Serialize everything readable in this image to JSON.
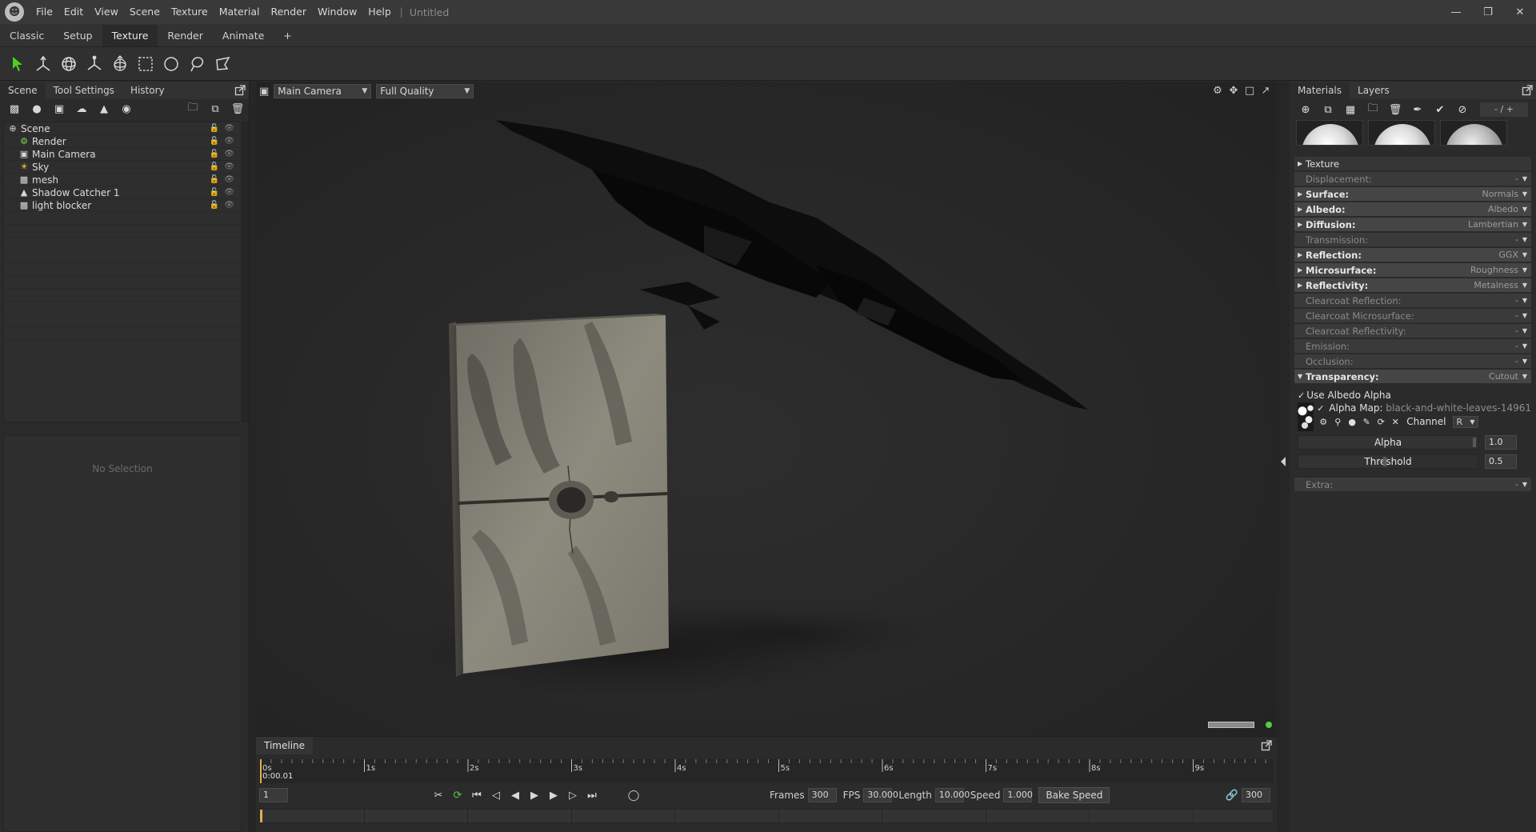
{
  "menubar": {
    "items": [
      "File",
      "Edit",
      "View",
      "Scene",
      "Texture",
      "Material",
      "Render",
      "Window",
      "Help"
    ],
    "separator": "|",
    "doc_title": "Untitled"
  },
  "modes": [
    "Classic",
    "Setup",
    "Texture",
    "Render",
    "Animate",
    "+"
  ],
  "active_mode": "Texture",
  "left_panel": {
    "tabs": [
      "Scene",
      "Tool Settings",
      "History"
    ],
    "tree": [
      {
        "label": "Scene",
        "icon": "scene-icon",
        "level": 0
      },
      {
        "label": "Render",
        "icon": "render-gear-icon",
        "level": 1
      },
      {
        "label": "Main Camera",
        "icon": "camera-icon",
        "level": 1
      },
      {
        "label": "Sky",
        "icon": "sky-icon",
        "level": 1
      },
      {
        "label": "mesh",
        "icon": "mesh-icon",
        "level": 1
      },
      {
        "label": "Shadow Catcher 1",
        "icon": "shadow-catcher-icon",
        "level": 1
      },
      {
        "label": "light blocker",
        "icon": "mesh-icon",
        "level": 1
      }
    ],
    "no_selection": "No Selection"
  },
  "viewport": {
    "camera": "Main Camera",
    "quality": "Full Quality"
  },
  "timeline": {
    "tab": "Timeline",
    "ruler_labels": [
      "0s",
      "1s",
      "2s",
      "3s",
      "4s",
      "5s",
      "6s",
      "7s",
      "8s",
      "9s"
    ],
    "current_time": "0:00.01",
    "frame_field": "1",
    "frames_label": "Frames",
    "frames_value": "300",
    "fps_label": "FPS",
    "fps_value": "30.000",
    "length_label": "Length",
    "length_value": "10.000",
    "speed_label": "Speed",
    "speed_value": "1.000",
    "bake_speed": "Bake Speed",
    "end_frame": "300"
  },
  "right_panel": {
    "tabs": [
      "Materials",
      "Layers"
    ],
    "counter": "- / +",
    "sections": [
      {
        "name": "Texture",
        "value": "",
        "style": "plain"
      },
      {
        "name": "Displacement:",
        "value": "-",
        "style": "dim"
      },
      {
        "name": "Surface:",
        "value": "Normals",
        "style": "bold"
      },
      {
        "name": "Albedo:",
        "value": "Albedo",
        "style": "bold"
      },
      {
        "name": "Diffusion:",
        "value": "Lambertian",
        "style": "bold"
      },
      {
        "name": "Transmission:",
        "value": "-",
        "style": "dim"
      },
      {
        "name": "Reflection:",
        "value": "GGX",
        "style": "bold"
      },
      {
        "name": "Microsurface:",
        "value": "Roughness",
        "style": "bold"
      },
      {
        "name": "Reflectivity:",
        "value": "Metalness",
        "style": "bold"
      },
      {
        "name": "Clearcoat Reflection:",
        "value": "-",
        "style": "dim"
      },
      {
        "name": "Clearcoat Microsurface:",
        "value": "-",
        "style": "dim"
      },
      {
        "name": "Clearcoat Reflectivity:",
        "value": "-",
        "style": "dim"
      },
      {
        "name": "Emission:",
        "value": "-",
        "style": "dim"
      },
      {
        "name": "Occlusion:",
        "value": "-",
        "style": "dim"
      }
    ],
    "transparency": {
      "name": "Transparency:",
      "value": "Cutout",
      "use_albedo_alpha": "Use Albedo Alpha",
      "alpha_map_label": "Alpha Map:",
      "alpha_map_file": "black-and-white-leaves-14961",
      "channel_label": "Channel",
      "channel_value": "R",
      "alpha_label": "Alpha",
      "alpha_value": "1.0",
      "alpha_level": 1.0,
      "threshold_label": "Threshold",
      "threshold_value": "0.5",
      "threshold_level": 0.5
    },
    "extra": {
      "name": "Extra:",
      "value": "-"
    }
  },
  "colors": {
    "accent_green": "#5cc93b",
    "select_arrow": "#49d21f",
    "keyframe": "#e0b04a"
  }
}
